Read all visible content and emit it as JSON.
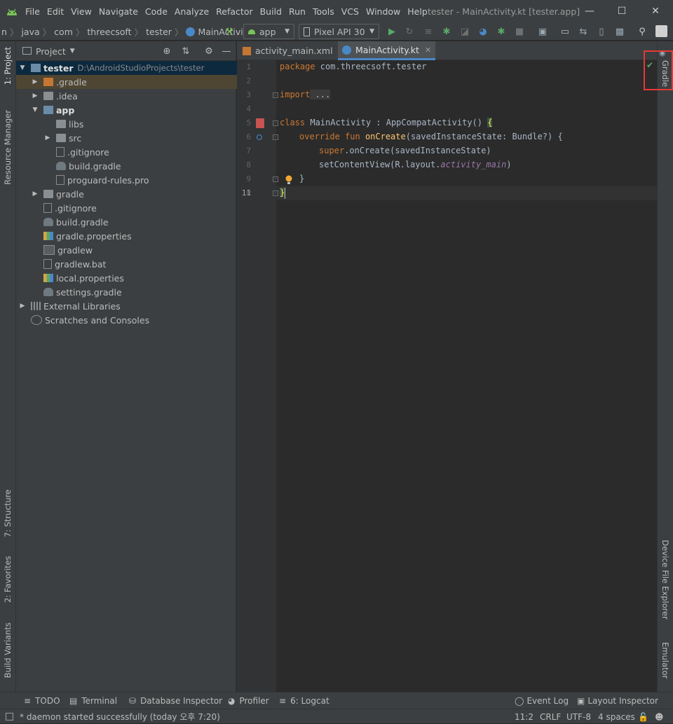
{
  "window": {
    "title": "tester - MainActivity.kt [tester.app]"
  },
  "menu": [
    "File",
    "Edit",
    "View",
    "Navigate",
    "Code",
    "Analyze",
    "Refactor",
    "Build",
    "Run",
    "Tools",
    "VCS",
    "Window",
    "Help"
  ],
  "breadcrumbs": [
    "n",
    "java",
    "com",
    "threecsoft",
    "tester",
    "MainActivity"
  ],
  "toolbar": {
    "run_config": "app",
    "device": "Pixel API 30"
  },
  "left_tools": {
    "project": "1: Project",
    "resource_manager": "Resource Manager",
    "structure": "7: Structure",
    "favorites": "2: Favorites",
    "build_variants": "Build Variants"
  },
  "right_tools": {
    "gradle": "Gradle",
    "device_file_explorer": "Device File Explorer",
    "emulator": "Emulator"
  },
  "project_panel": {
    "title": "Project",
    "tree": [
      {
        "label": "tester",
        "path": "D:\\AndroidStudioProjects\\tester"
      },
      {
        "label": ".gradle"
      },
      {
        "label": ".idea"
      },
      {
        "label": "app"
      },
      {
        "label": "libs"
      },
      {
        "label": "src"
      },
      {
        "label": ".gitignore"
      },
      {
        "label": "build.gradle"
      },
      {
        "label": "proguard-rules.pro"
      },
      {
        "label": "gradle"
      },
      {
        "label": ".gitignore"
      },
      {
        "label": "build.gradle"
      },
      {
        "label": "gradle.properties"
      },
      {
        "label": "gradlew"
      },
      {
        "label": "gradlew.bat"
      },
      {
        "label": "local.properties"
      },
      {
        "label": "settings.gradle"
      },
      {
        "label": "External Libraries"
      },
      {
        "label": "Scratches and Consoles"
      }
    ]
  },
  "editor": {
    "tabs": [
      "activity_main.xml",
      "MainActivity.kt"
    ],
    "line_numbers": [
      "1",
      "2",
      "3",
      "4",
      "5",
      "6",
      "7",
      "8",
      "9",
      "10",
      "11"
    ],
    "code": {
      "l1_kw": "package",
      "l1_rest": " com.threecsoft.tester",
      "l3_kw": "import",
      "l3_rest": " ...",
      "l6_kw": "class",
      "l6_rest": " MainActivity : AppCompatActivity() ",
      "l6_brace": "{",
      "l7_kw": "override fun",
      "l7_fn": "onCreate",
      "l7_rest": "(savedInstanceState: Bundle?) {",
      "l8_kw": "super",
      "l8_rest": ".onCreate(savedInstanceState)",
      "l9_rest": "setContentView(R.layout.",
      "l9_it": "activity_main",
      "l9_end": ")",
      "l10": "}",
      "l11": "}"
    }
  },
  "bottom_tools": {
    "todo": "TODO",
    "terminal": "Terminal",
    "database": "Database Inspector",
    "profiler": "Profiler",
    "logcat": "6: Logcat",
    "event_log": "Event Log",
    "layout_inspector": "Layout Inspector"
  },
  "status": {
    "message": "* daemon started successfully (today 오후 7:20)",
    "position": "11:2",
    "line_sep": "CRLF",
    "encoding": "UTF-8",
    "indent": "4 spaces"
  },
  "colors": {
    "accent": "#4a88c7",
    "keyword": "#cc7832",
    "function": "#ffc66d",
    "highlight_box": "#e53935"
  }
}
